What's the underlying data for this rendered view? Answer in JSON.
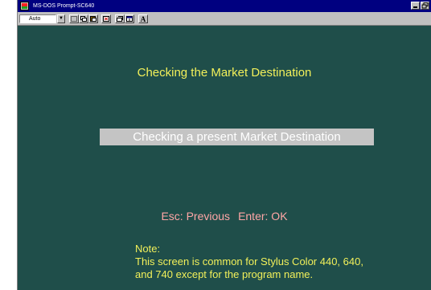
{
  "window": {
    "title": "MS-DOS Prompt-SC640",
    "controls": [
      "minimize-icon",
      "restore-icon"
    ]
  },
  "toolbar": {
    "font_size_value": "Auto",
    "buttons": [
      "mark-icon",
      "copy-icon",
      "paste-icon",
      "full-screen-icon",
      "properties-icon",
      "background-icon",
      "font-icon"
    ],
    "font_button_label": "A"
  },
  "screen": {
    "heading": "Checking the Market Destination",
    "selected_option": "Checking a present Market Destination",
    "keys": {
      "esc": "Esc: Previous",
      "enter": "Enter: OK"
    },
    "colors": {
      "background": "#1f4e4a",
      "heading": "#f2f05a",
      "highlight_bar": "#c4c4c4",
      "keys_text": "#ffa6a6"
    }
  },
  "note": {
    "label": "Note:",
    "line1": "This screen is common for Stylus Color 440, 640,",
    "line2": "and 740 except for the program name."
  }
}
